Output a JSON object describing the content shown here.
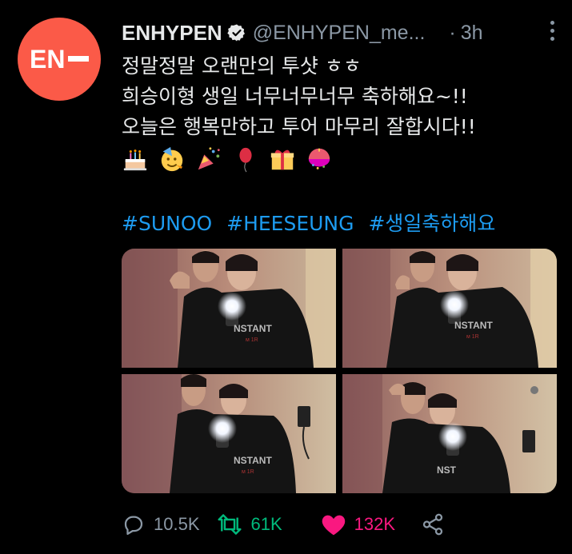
{
  "tweet": {
    "display_name": "ENHYPEN",
    "handle": "@ENHYPEN_me...",
    "separator": "·",
    "time": "3h",
    "avatar_text": "EN",
    "lines": [
      "정말정말 오랜만의 투샷 ㅎㅎ",
      "희승이형 생일 너무너무너무 축하해요~!!",
      "오늘은 행복만하고 투어 마무리 잘합시다!!"
    ],
    "emojis": [
      "birthday-cake-icon",
      "partying-face-icon",
      "party-popper-icon",
      "balloon-icon",
      "gift-icon",
      "confetti-ball-icon"
    ],
    "hashtags": [
      "#SUNOO",
      "#HEESEUNG",
      "#생일축하해요"
    ],
    "photos": [
      {
        "name": "photo-1"
      },
      {
        "name": "photo-2"
      },
      {
        "name": "photo-3"
      },
      {
        "name": "photo-4"
      }
    ],
    "metrics": {
      "replies": "10.5K",
      "retweets": "61K",
      "likes": "132K"
    }
  },
  "colors": {
    "background": "#000000",
    "text": "#e7e9ea",
    "secondary": "#8b98a5",
    "link": "#1d9bf0",
    "retweet": "#00ba7c",
    "like": "#f91880",
    "avatar": "#fb5a48"
  }
}
